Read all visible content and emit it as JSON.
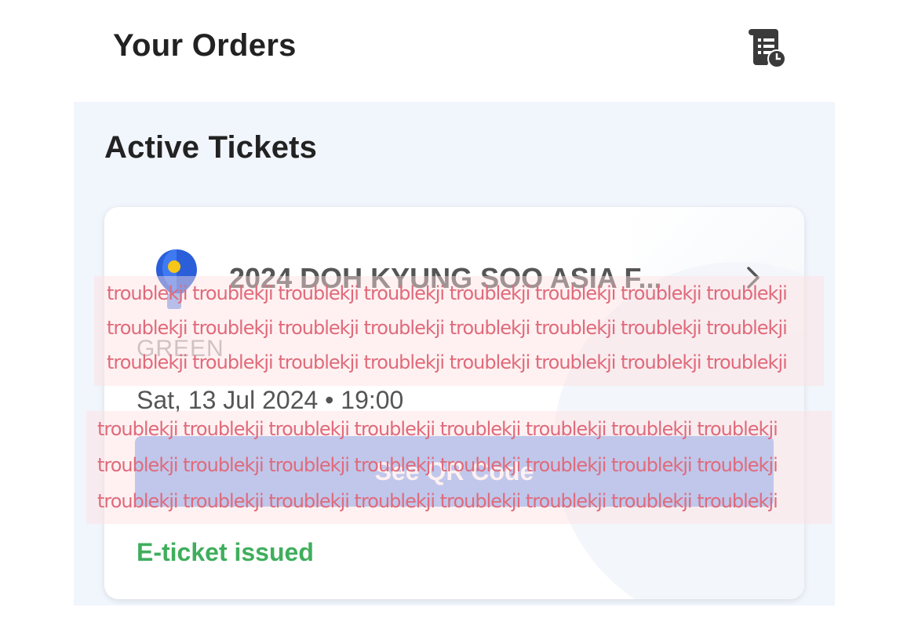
{
  "header": {
    "title": "Your Orders",
    "history_icon": "order-history-icon"
  },
  "section": {
    "title": "Active Tickets"
  },
  "ticket": {
    "event_name": "2024 DOH KYUNG SOO ASIA F...",
    "seat_type": "GREEN",
    "date": "Sat, 13 Jul 2024 • 19:00",
    "qr_button_label": "See QR Code",
    "status": "E-ticket issued",
    "logo_icon": "map-pin-balloon-icon",
    "chevron_icon": "chevron-right-icon"
  },
  "watermark": {
    "line": "troublekji troublekji troublekji troublekji troublekji troublekji troublekji troublekji"
  },
  "colors": {
    "accent_button": "#8db3f4",
    "status_green": "#3fae5c",
    "panel_bg": "#f1f5fc",
    "watermark": "#e06a7b"
  }
}
